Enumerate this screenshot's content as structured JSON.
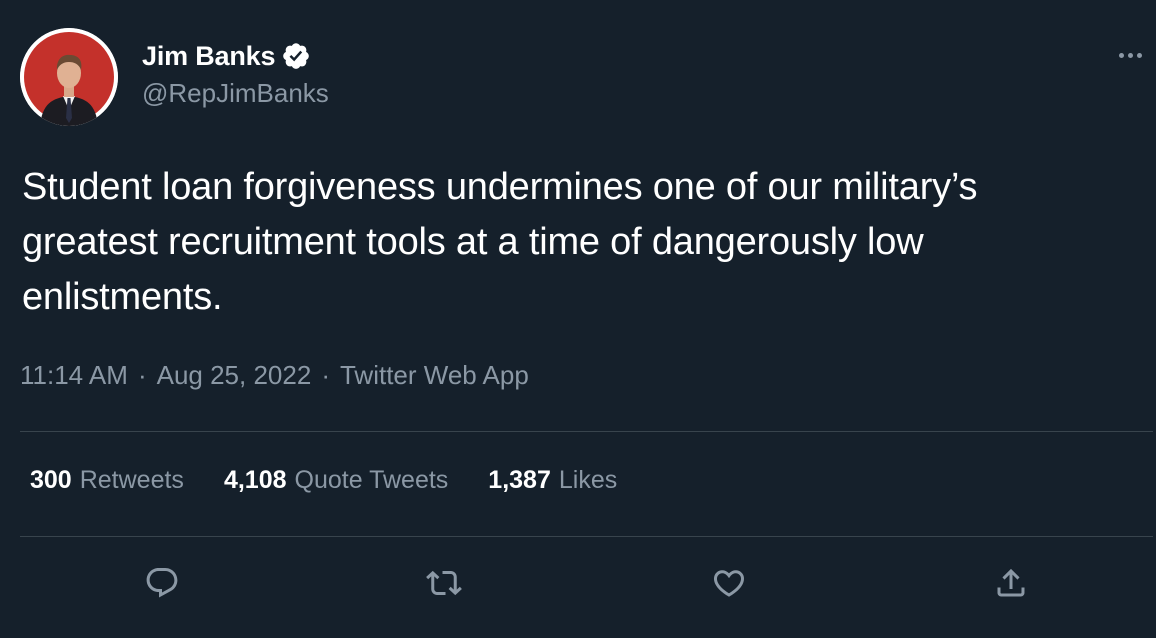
{
  "author": {
    "display_name": "Jim Banks",
    "handle": "@RepJimBanks",
    "verified": true,
    "avatar_icon": "profile-photo"
  },
  "tweet": {
    "text": "Student loan forgiveness undermines one of our military’s greatest recruitment tools at a time of dangerously low enlistments.",
    "time": "11:14 AM",
    "date": "Aug 25, 2022",
    "source": "Twitter Web App",
    "separator": "·"
  },
  "stats": {
    "retweets_count": "300",
    "retweets_label": "Retweets",
    "quotes_count": "4,108",
    "quotes_label": "Quote Tweets",
    "likes_count": "1,387",
    "likes_label": "Likes"
  },
  "actions": {
    "reply_icon": "reply-icon",
    "retweet_icon": "retweet-icon",
    "like_icon": "heart-icon",
    "share_icon": "share-icon"
  },
  "colors": {
    "background": "#15202b",
    "primary_text": "#ffffff",
    "secondary_text": "#8b98a5",
    "divider": "#38444d",
    "verified_badge": "#ffffff"
  }
}
